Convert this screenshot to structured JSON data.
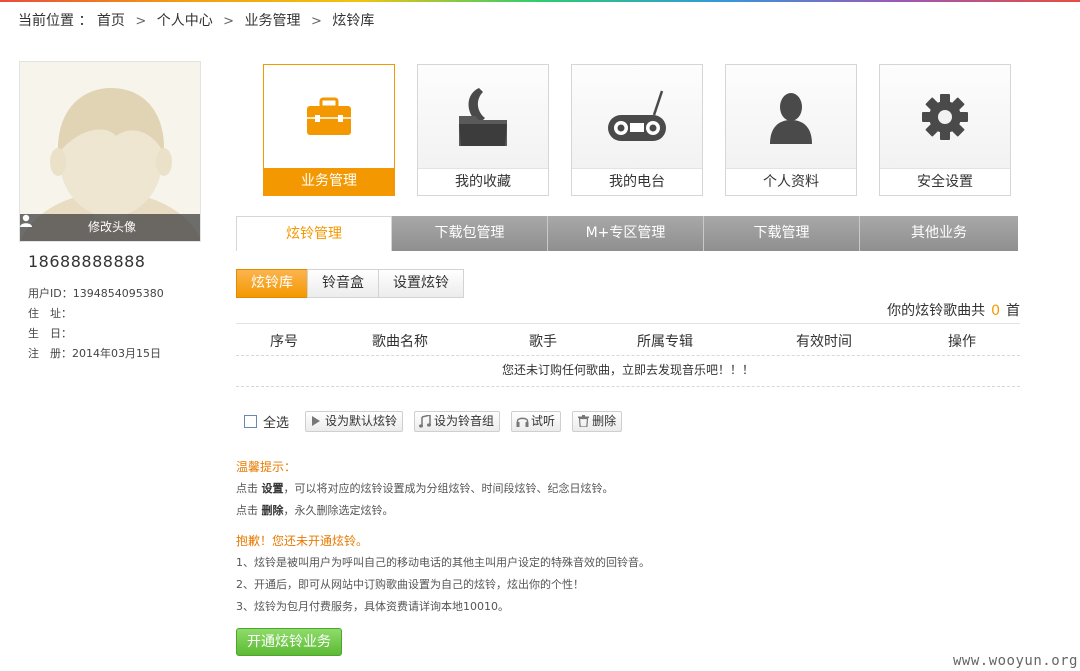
{
  "breadcrumb": {
    "label": "当前位置 ：",
    "items": [
      "首页",
      "个人中心",
      "业务管理",
      "炫铃库"
    ],
    "separator": ">"
  },
  "profile": {
    "edit_avatar": "修改头像",
    "phone": "18688888888",
    "user_id": "用户ID：1394854095380",
    "address": "住　址：",
    "birthday": "生　日：",
    "register": "注　册：2014年03月15日"
  },
  "tiles": [
    {
      "label": "业务管理",
      "icon": "briefcase-icon",
      "active": true
    },
    {
      "label": "我的收藏",
      "icon": "folder-icon",
      "active": false
    },
    {
      "label": "我的电台",
      "icon": "radio-icon",
      "active": false
    },
    {
      "label": "个人资料",
      "icon": "person-icon",
      "active": false
    },
    {
      "label": "安全设置",
      "icon": "gear-icon",
      "active": false
    }
  ],
  "tabs": [
    "炫铃管理",
    "下载包管理",
    "M+专区管理",
    "下载管理",
    "其他业务"
  ],
  "subtabs": [
    "炫铃库",
    "铃音盒",
    "设置炫铃"
  ],
  "count": {
    "prefix": "你的炫铃歌曲共",
    "value": "0",
    "suffix": "首"
  },
  "table": {
    "headers": [
      "序号",
      "歌曲名称",
      "歌手",
      "所属专辑",
      "有效时间",
      "操作"
    ],
    "empty": "您还未订购任何歌曲，立即去发现音乐吧！！！"
  },
  "actions": {
    "select_all": "全选",
    "set_default": "设为默认炫铃",
    "set_group": "设为铃音组",
    "listen": "试听",
    "delete": "删除"
  },
  "tips": {
    "title": "温馨提示：",
    "line1_a": "点击",
    "line1_b": "设置",
    "line1_c": "，可以将对应的炫铃设置成为分组炫铃、时间段炫铃、纪念日炫铃。",
    "line2_a": "点击",
    "line2_b": "删除",
    "line2_c": "，永久删除选定炫铃。",
    "notice": "抱歉！您还未开通炫铃。",
    "n1": "1、炫铃是被叫用户为呼叫自己的移动电话的其他主叫用户设定的特殊音效的回铃音。",
    "n2": "2、开通后，即可从网站中订购歌曲设置为自己的炫铃，炫出你的个性！",
    "n3": "3、炫铃为包月付费服务，具体资费请详询本地10010。"
  },
  "open_button": "开通炫铃业务",
  "watermark": "www.wooyun.org",
  "colors": {
    "accent": "#f39800",
    "green": "#5cba35",
    "tab_gray": "#9a9a9a"
  }
}
